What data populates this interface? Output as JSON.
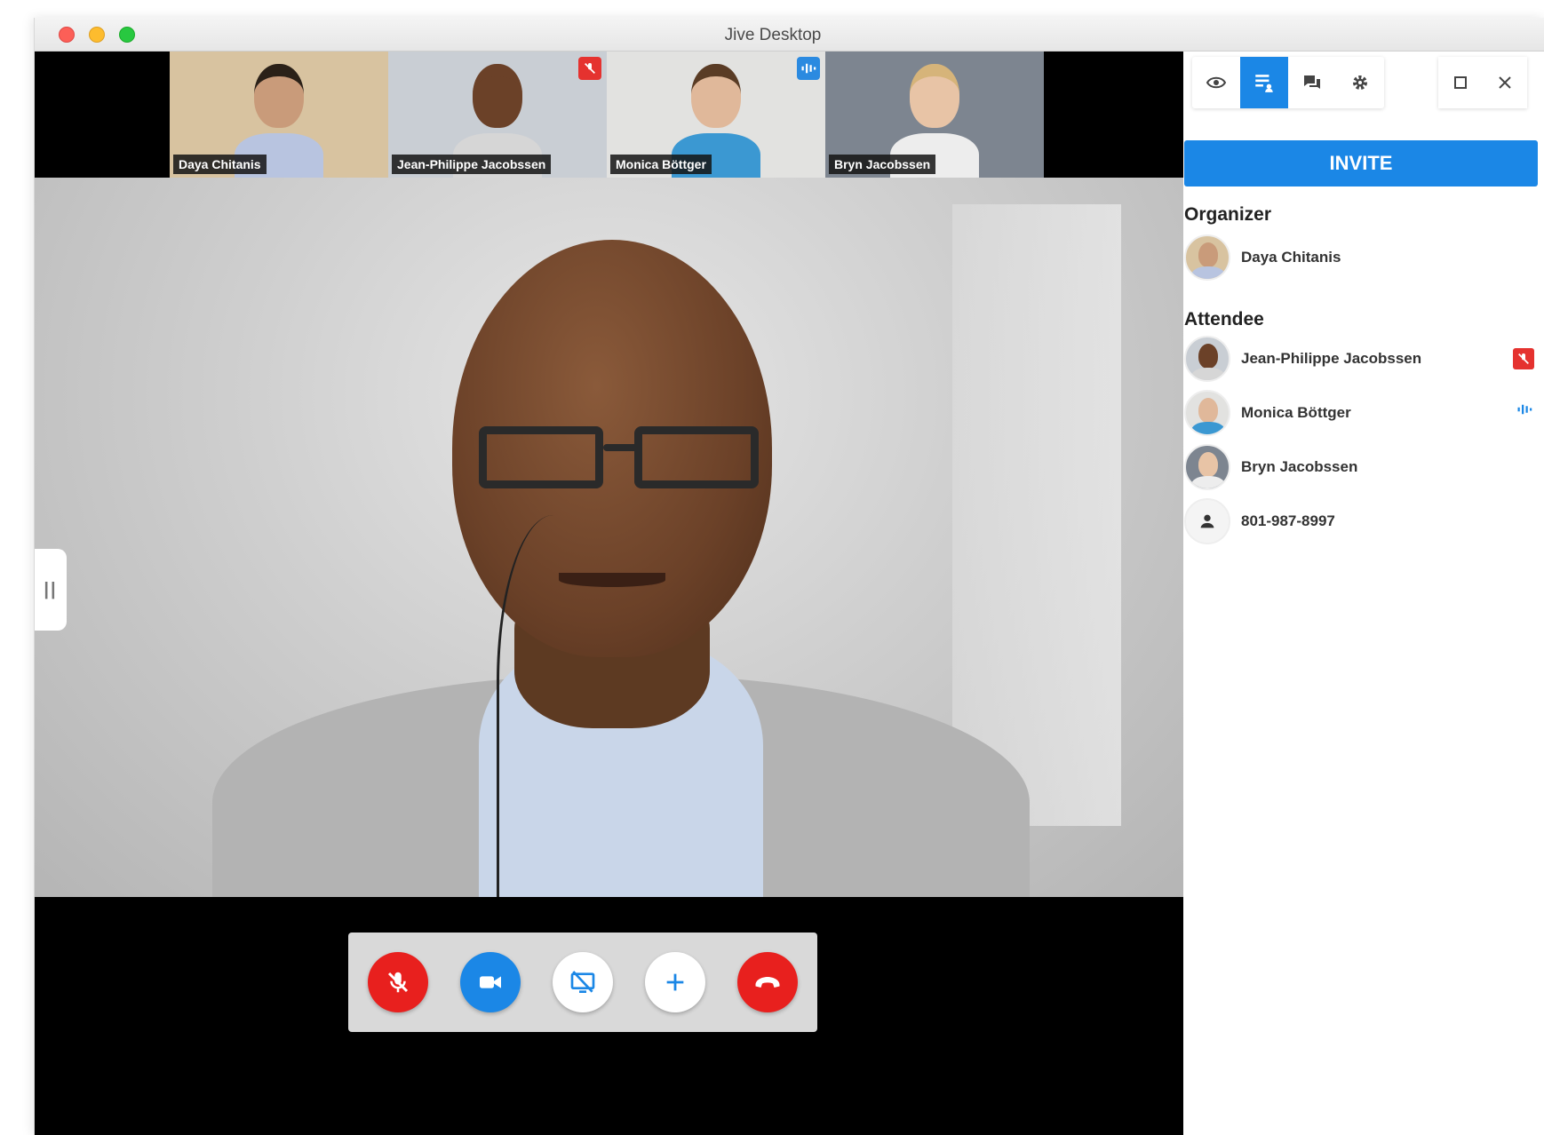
{
  "window": {
    "title": "Jive Desktop"
  },
  "thumbnails": [
    {
      "name": "Daya Chitanis",
      "muted": false,
      "speaking": false,
      "active": false,
      "bg": "#d8c3a0",
      "skin": "#c99b7a",
      "hair": "#2b2118",
      "shirt": "#b8c4e0"
    },
    {
      "name": "Jean-Philippe Jacobssen",
      "muted": true,
      "speaking": false,
      "active": true,
      "bg": "#c9ced4",
      "skin": "#6b4128",
      "hair": "#6b4128",
      "shirt": "#d6d6d6"
    },
    {
      "name": "Monica Böttger",
      "muted": false,
      "speaking": true,
      "active": false,
      "bg": "#e2e2e0",
      "skin": "#e0b89a",
      "hair": "#5a3c25",
      "shirt": "#3b98d2"
    },
    {
      "name": "Bryn Jacobssen",
      "muted": false,
      "speaking": false,
      "active": false,
      "bg": "#7d8590",
      "skin": "#e8c4a6",
      "hair": "#d6b47a",
      "shirt": "#ededed"
    }
  ],
  "controls": [
    {
      "id": "mute",
      "icon": "mic-off-icon",
      "style": "red"
    },
    {
      "id": "camera",
      "icon": "camera-icon",
      "style": "blue"
    },
    {
      "id": "screen",
      "icon": "screen-share-off-icon",
      "style": "white"
    },
    {
      "id": "add",
      "icon": "plus-icon",
      "style": "white"
    },
    {
      "id": "hangup",
      "icon": "phone-hangup-icon",
      "style": "red"
    }
  ],
  "sidebar": {
    "tools": [
      {
        "id": "view",
        "icon": "eye-icon",
        "active": false
      },
      {
        "id": "participants",
        "icon": "participants-list-icon",
        "active": true
      },
      {
        "id": "chat",
        "icon": "chat-icon",
        "active": false
      },
      {
        "id": "settings",
        "icon": "gear-icon",
        "active": false
      }
    ],
    "invite_label": "INVITE",
    "organizer_title": "Organizer",
    "organizer": {
      "name": "Daya Chitanis"
    },
    "attendee_title": "Attendee",
    "attendees": [
      {
        "name": "Jean-Philippe Jacobssen",
        "status": "muted"
      },
      {
        "name": "Monica Böttger",
        "status": "speaking"
      },
      {
        "name": "Bryn Jacobssen",
        "status": ""
      },
      {
        "name": "801-987-8997",
        "status": "",
        "phone": true
      }
    ]
  },
  "colors": {
    "accent": "#1b87e6",
    "danger": "#e8201e",
    "background": "#000000"
  }
}
